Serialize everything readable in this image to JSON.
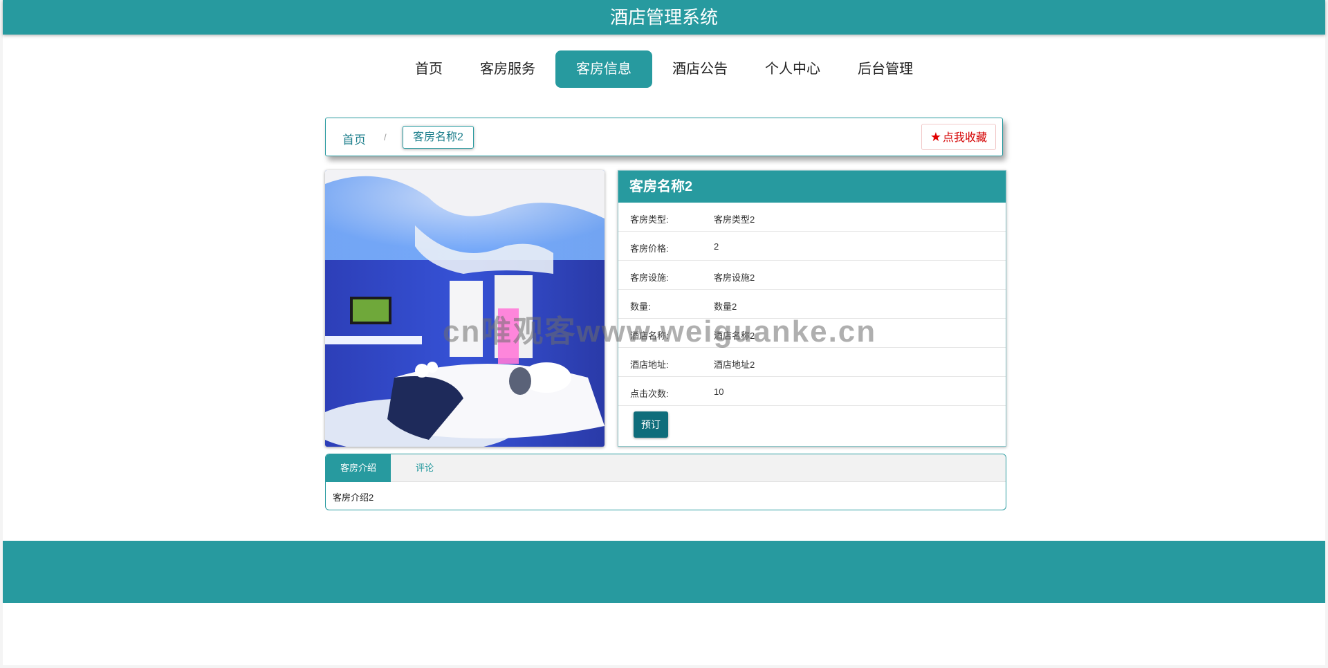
{
  "header": {
    "title": "酒店管理系统"
  },
  "nav": {
    "items": [
      {
        "label": "首页"
      },
      {
        "label": "客房服务"
      },
      {
        "label": "客房信息"
      },
      {
        "label": "酒店公告"
      },
      {
        "label": "个人中心"
      },
      {
        "label": "后台管理"
      }
    ],
    "active_index": 2
  },
  "breadcrumb": {
    "home": "首页",
    "separator": "/",
    "current": "客房名称2",
    "favorite_label": "点我收藏",
    "favorite_icon": "star-icon"
  },
  "room": {
    "title": "客房名称2",
    "fields": [
      {
        "label": "客房类型:",
        "value": "客房类型2"
      },
      {
        "label": "客房价格:",
        "value": "2"
      },
      {
        "label": "客房设施:",
        "value": "客房设施2"
      },
      {
        "label": "数量:",
        "value": "数量2"
      },
      {
        "label": "酒店名称:",
        "value": "酒店名称2"
      },
      {
        "label": "酒店地址:",
        "value": "酒店地址2"
      },
      {
        "label": "点击次数:",
        "value": "10"
      }
    ],
    "book_label": "预订"
  },
  "tabs": {
    "items": [
      {
        "label": "客房介绍"
      },
      {
        "label": "评论"
      }
    ],
    "content": "客房介绍2"
  },
  "watermark": "cn唯观客www.weiguanke.cn",
  "colors": {
    "primary": "#279a9f",
    "button": "#0f6d7b",
    "favorite": "#d40000"
  }
}
